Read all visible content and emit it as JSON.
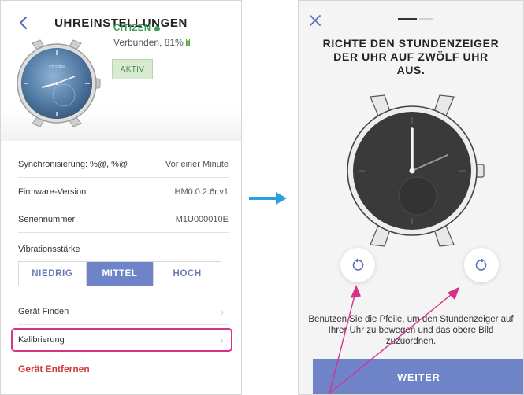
{
  "left_screen": {
    "header": {
      "title": "UHREINSTELLUNGEN",
      "back_icon": "chevron-left-icon"
    },
    "device": {
      "brand": "CITIZEN",
      "status": "Verbunden, 81%",
      "battery_level": 0.81,
      "badge": "AKTIV",
      "watch_logo": "CITIZEN"
    },
    "rows": [
      {
        "label": "Synchronisierung: %@, %@",
        "value": "Vor einer Minute"
      },
      {
        "label": "Firmware-Version",
        "value": "HM0.0.2.6r.v1"
      },
      {
        "label": "Seriennummer",
        "value": "M1U000010E"
      }
    ],
    "vibration": {
      "label": "Vibrationsstärke",
      "options": [
        "NIEDRIG",
        "MITTEL",
        "HOCH"
      ],
      "selected": "MITTEL"
    },
    "nav": {
      "find_device": "Gerät Finden",
      "calibration": "Kalibrierung"
    },
    "remove_device": "Gerät Entfernen"
  },
  "right_screen": {
    "close_icon": "close-icon",
    "progress": {
      "current_step": 1,
      "total_steps": 2
    },
    "heading": "RICHTE DEN STUNDENZEIGER DER UHR AUF ZWÖLF UHR AUS.",
    "rotate_left_icon": "rotate-counterclockwise-icon",
    "rotate_right_icon": "rotate-clockwise-icon",
    "instruction": "Benutzen Sie die Pfeile, um den Stundenzeiger auf Ihrer Uhr zu bewegen und das obere Bild zuzuordnen.",
    "next_button": "WEITER"
  },
  "colors": {
    "accent": "#6f84c8",
    "connected_green": "#3aa15a",
    "danger_red": "#d23a3a",
    "highlight_pink": "#d6328c",
    "arrow_blue": "#2aa0e0"
  }
}
